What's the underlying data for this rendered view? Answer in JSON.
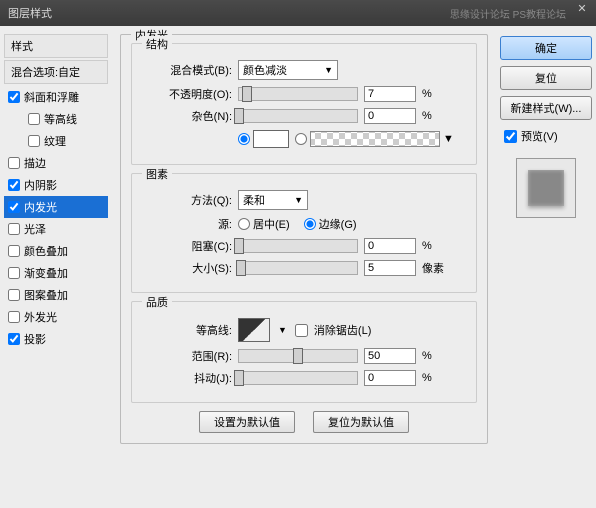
{
  "window": {
    "title": "图层样式",
    "watermark": "思缘设计论坛  PS教程论坛"
  },
  "sidebar": {
    "header": "样式",
    "sub": "混合选项:自定",
    "items": [
      {
        "label": "斜面和浮雕",
        "checked": true,
        "indent": false
      },
      {
        "label": "等高线",
        "checked": false,
        "indent": true
      },
      {
        "label": "纹理",
        "checked": false,
        "indent": true
      },
      {
        "label": "描边",
        "checked": false,
        "indent": false
      },
      {
        "label": "内阴影",
        "checked": true,
        "indent": false
      },
      {
        "label": "内发光",
        "checked": true,
        "indent": false,
        "selected": true
      },
      {
        "label": "光泽",
        "checked": false,
        "indent": false
      },
      {
        "label": "颜色叠加",
        "checked": false,
        "indent": false
      },
      {
        "label": "渐变叠加",
        "checked": false,
        "indent": false
      },
      {
        "label": "图案叠加",
        "checked": false,
        "indent": false
      },
      {
        "label": "外发光",
        "checked": false,
        "indent": false
      },
      {
        "label": "投影",
        "checked": true,
        "indent": false
      }
    ]
  },
  "panel": {
    "title": "内发光",
    "struct": {
      "title": "结构",
      "blend_label": "混合模式(B):",
      "blend_value": "颜色减淡",
      "opacity_label": "不透明度(O):",
      "opacity_value": "7",
      "noise_label": "杂色(N):",
      "noise_value": "0",
      "pct": "%"
    },
    "elements": {
      "title": "图素",
      "technique_label": "方法(Q):",
      "technique_value": "柔和",
      "source_label": "源:",
      "source_center": "居中(E)",
      "source_edge": "边缘(G)",
      "choke_label": "阻塞(C):",
      "choke_value": "0",
      "size_label": "大小(S):",
      "size_value": "5",
      "pct": "%",
      "px": "像素"
    },
    "quality": {
      "title": "品质",
      "contour_label": "等高线:",
      "antialias_label": "消除锯齿(L)",
      "range_label": "范围(R):",
      "range_value": "50",
      "jitter_label": "抖动(J):",
      "jitter_value": "0",
      "pct": "%"
    },
    "buttons": {
      "default": "设置为默认值",
      "reset": "复位为默认值"
    }
  },
  "right": {
    "ok": "确定",
    "cancel": "复位",
    "newstyle": "新建样式(W)...",
    "preview": "预览(V)"
  }
}
